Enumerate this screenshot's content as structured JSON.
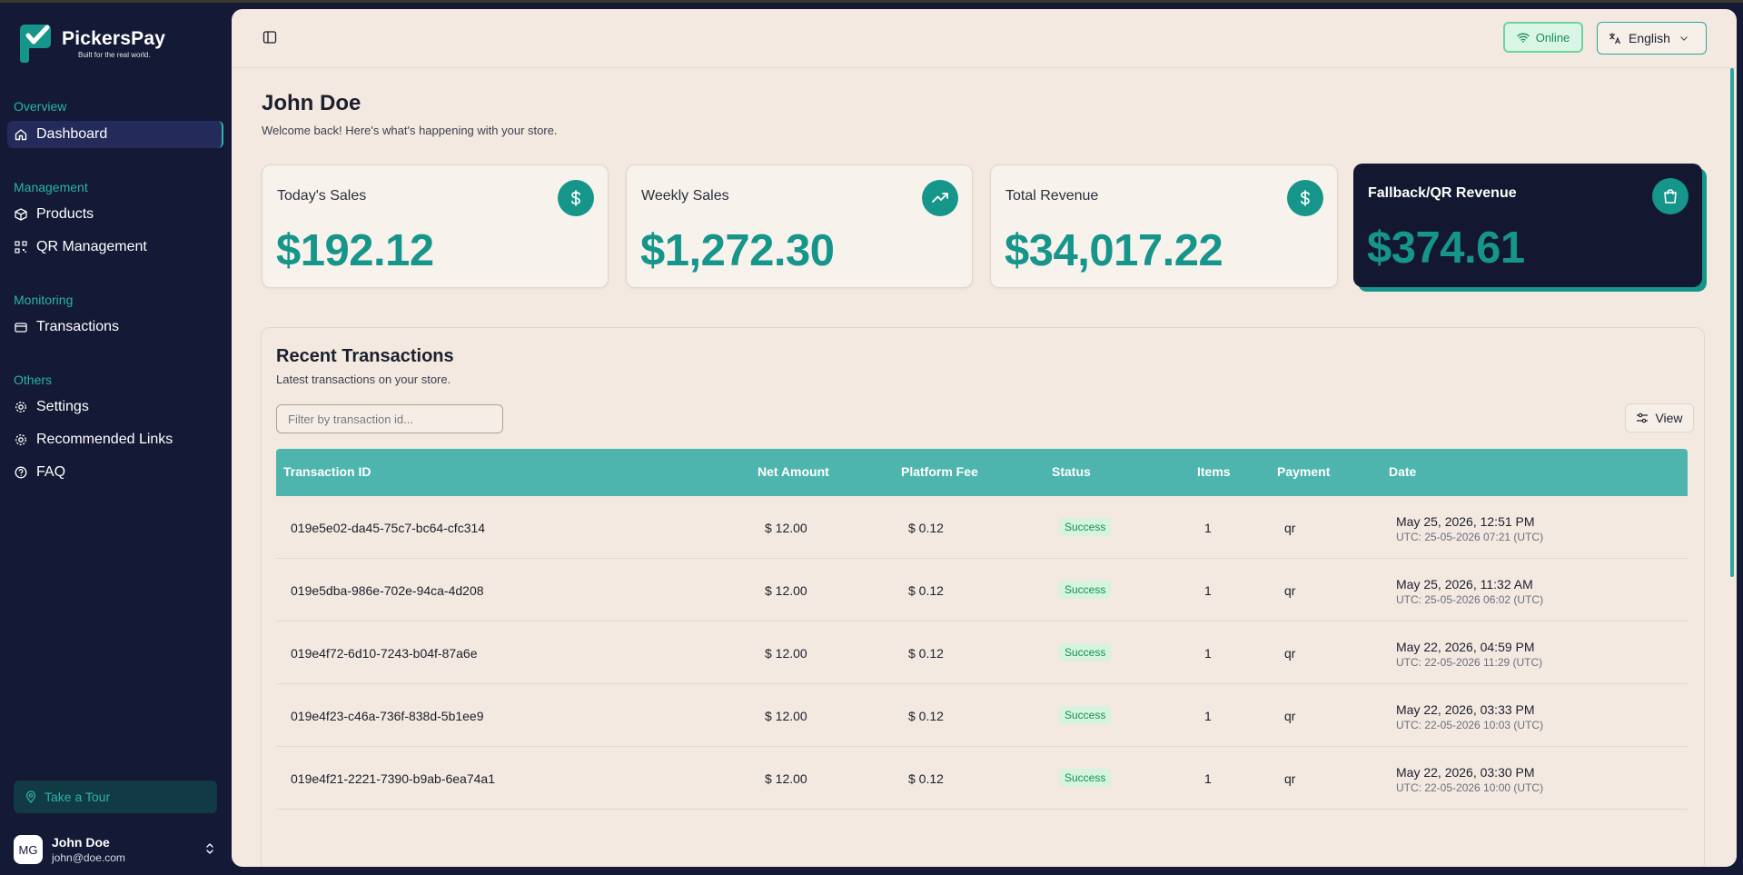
{
  "app": {
    "name": "PickersPay",
    "tagline": "Built for the real world."
  },
  "sidebar": {
    "sections": [
      {
        "label": "Overview",
        "items": [
          {
            "label": "Dashboard",
            "icon": "home-icon",
            "active": true
          }
        ]
      },
      {
        "label": "Management",
        "items": [
          {
            "label": "Products",
            "icon": "box-icon"
          },
          {
            "label": "QR Management",
            "icon": "qr-icon"
          }
        ]
      },
      {
        "label": "Monitoring",
        "items": [
          {
            "label": "Transactions",
            "icon": "card-icon"
          }
        ]
      },
      {
        "label": "Others",
        "items": [
          {
            "label": "Settings",
            "icon": "gear-icon"
          },
          {
            "label": "Recommended Links",
            "icon": "gear-icon"
          },
          {
            "label": "FAQ",
            "icon": "help-circle-icon"
          }
        ]
      }
    ],
    "tour_label": "Take a Tour",
    "user": {
      "initials": "MG",
      "name": "John Doe",
      "email": "john@doe.com"
    }
  },
  "topbar": {
    "status": "Online",
    "language": "English"
  },
  "header": {
    "title": "John Doe",
    "subtitle": "Welcome back! Here's what's happening with your store."
  },
  "stats": [
    {
      "title": "Today's Sales",
      "value": "$192.12",
      "icon": "dollar-icon"
    },
    {
      "title": "Weekly Sales",
      "value": "$1,272.30",
      "icon": "trending-up-icon"
    },
    {
      "title": "Total Revenue",
      "value": "$34,017.22",
      "icon": "dollar-icon"
    },
    {
      "title": "Fallback/QR Revenue",
      "value": "$374.61",
      "icon": "shopping-bag-icon"
    }
  ],
  "transactions": {
    "title": "Recent Transactions",
    "subtitle": "Latest transactions on your store.",
    "filter_placeholder": "Filter by transaction id...",
    "view_label": "View",
    "columns": [
      "Transaction ID",
      "Net Amount",
      "Platform Fee",
      "Status",
      "Items",
      "Payment",
      "Date"
    ],
    "rows": [
      {
        "id": "019e5e02-da45-75c7-bc64-cfc314",
        "net": "$ 12.00",
        "fee": "$ 0.12",
        "status": "Success",
        "items": "1",
        "payment": "qr",
        "date": "May 25, 2026, 12:51 PM",
        "utc": "UTC: 25-05-2026 07:21 (UTC)"
      },
      {
        "id": "019e5dba-986e-702e-94ca-4d208",
        "net": "$ 12.00",
        "fee": "$ 0.12",
        "status": "Success",
        "items": "1",
        "payment": "qr",
        "date": "May 25, 2026, 11:32 AM",
        "utc": "UTC: 25-05-2026 06:02 (UTC)"
      },
      {
        "id": "019e4f72-6d10-7243-b04f-87a6e",
        "net": "$ 12.00",
        "fee": "$ 0.12",
        "status": "Success",
        "items": "1",
        "payment": "qr",
        "date": "May 22, 2026, 04:59 PM",
        "utc": "UTC: 22-05-2026 11:29 (UTC)"
      },
      {
        "id": "019e4f23-c46a-736f-838d-5b1ee9",
        "net": "$ 12.00",
        "fee": "$ 0.12",
        "status": "Success",
        "items": "1",
        "payment": "qr",
        "date": "May 22, 2026, 03:33 PM",
        "utc": "UTC: 22-05-2026 10:03 (UTC)"
      },
      {
        "id": "019e4f21-2221-7390-b9ab-6ea74a1",
        "net": "$ 12.00",
        "fee": "$ 0.12",
        "status": "Success",
        "items": "1",
        "payment": "qr",
        "date": "May 22, 2026, 03:30 PM",
        "utc": "UTC: 22-05-2026 10:00 (UTC)"
      }
    ]
  },
  "colors": {
    "sidebar": "#141935",
    "accent": "#16958a",
    "table_header": "#4db5ae",
    "main_bg": "#f3e9e0"
  }
}
